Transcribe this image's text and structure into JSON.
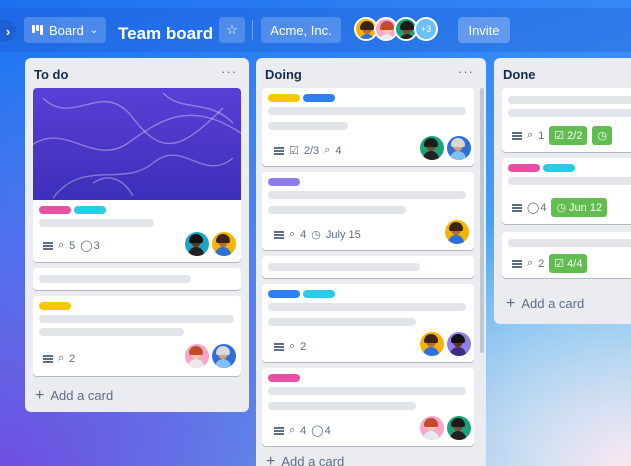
{
  "board": {
    "view_label": "Board",
    "title": "Team board",
    "workspace": "Acme, Inc.",
    "member_overflow": "+3",
    "invite_label": "Invite"
  },
  "lists": [
    {
      "title": "To do",
      "menu": "···",
      "add_card": "Add a card",
      "cards": [
        {
          "attachments": "5",
          "comments": "3"
        },
        {},
        {
          "attachments": "2"
        }
      ]
    },
    {
      "title": "Doing",
      "menu": "···",
      "add_card": "Add a card",
      "cards": [
        {
          "checklist": "2/3",
          "attachments": "4"
        },
        {
          "attachments": "4",
          "due": "July 15"
        },
        {},
        {
          "attachments": "2"
        },
        {
          "attachments": "4",
          "comments": "4"
        }
      ]
    },
    {
      "title": "Done",
      "add_card": "Add a card",
      "cards": [
        {
          "attachments": "1",
          "checklist": "2/2"
        },
        {
          "comments": "4",
          "due": "Jun 12"
        },
        {
          "attachments": "2",
          "checklist": "4/4"
        }
      ]
    }
  ],
  "colors": {
    "label_pink": "#e84fa5",
    "label_teal": "#29cce5",
    "label_yellow": "#f5c900",
    "label_blue": "#2f7ff0",
    "label_purple": "#8f7ee7",
    "badge_green": "#61bd4f"
  }
}
